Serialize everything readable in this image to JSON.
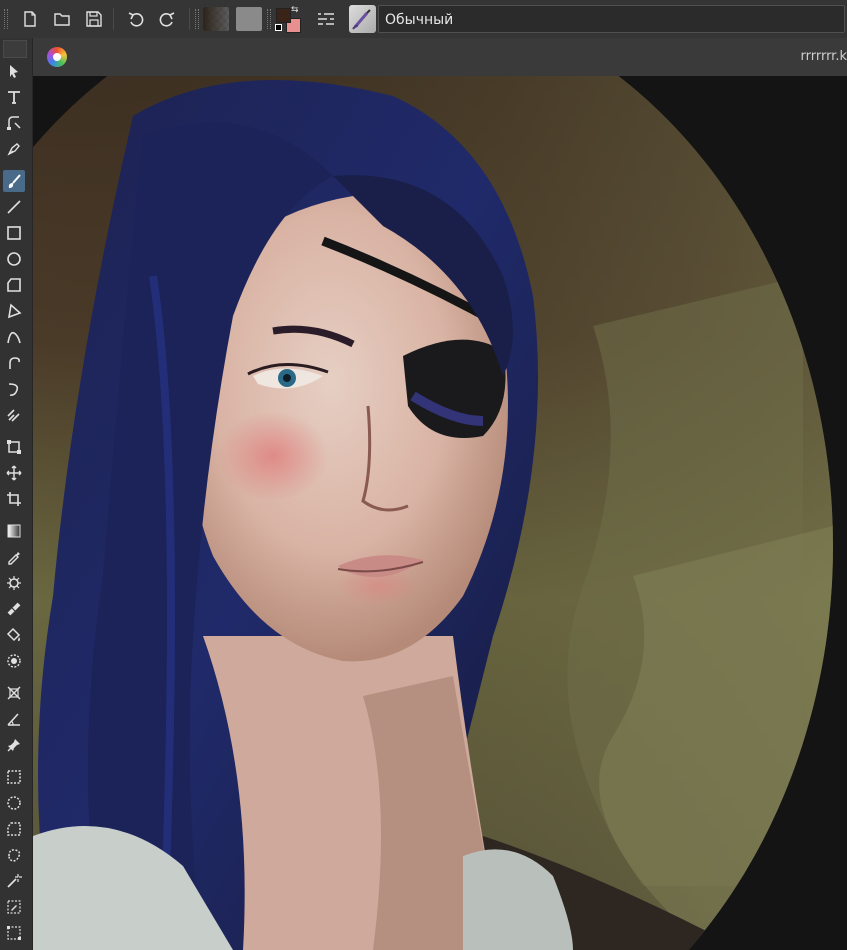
{
  "toolbar": {
    "preset_name": "Обычный",
    "foreground_color": "#3a2418",
    "background_color": "#e89090"
  },
  "document": {
    "tab_title": "rrrrrrr.k"
  },
  "toolbox": {
    "active_tool": "freehand-brush-tool"
  }
}
